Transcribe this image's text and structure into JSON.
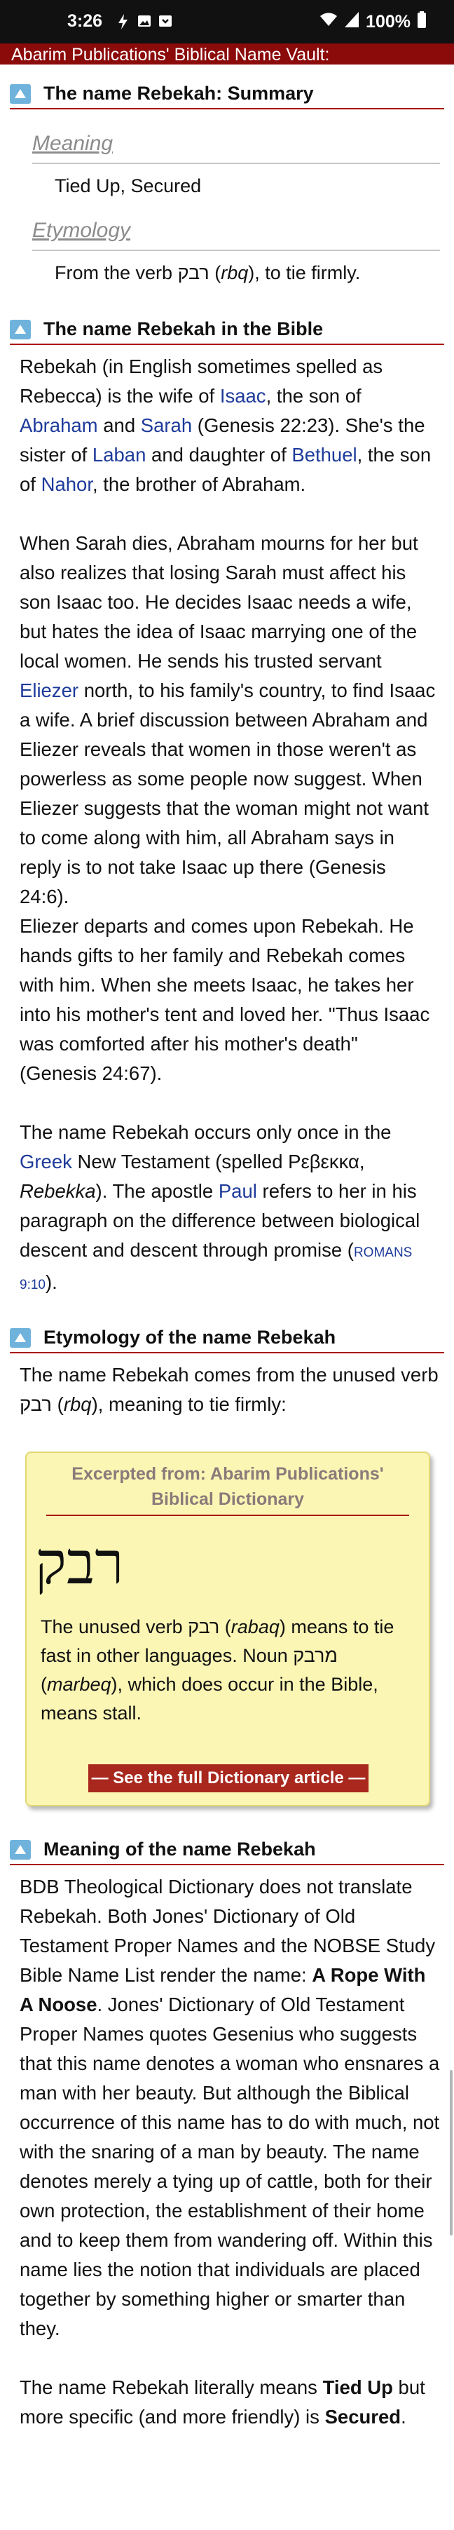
{
  "status_bar": {
    "time": "3:26",
    "battery": "100%"
  },
  "header": {
    "title": "Abarim Publications' Biblical Name Vault:"
  },
  "sections": {
    "summary": {
      "title": "The name Rebekah: Summary",
      "meaning_label": "Meaning",
      "meaning_value": "Tied Up, Secured",
      "etym_label": "Etymology",
      "etym_value_pre": "From the verb ",
      "etym_heb": "רבק",
      "etym_paren_open": " (",
      "etym_translit": "rbq",
      "etym_value_post": "), to tie firmly."
    },
    "bible": {
      "title": "The name Rebekah in the Bible",
      "p1": {
        "t1": "Rebekah (in English sometimes spelled as Rebecca) is the wife of ",
        "isaac": "Isaac",
        "t2": ", the son of ",
        "abraham": "Abraham",
        "t3": " and ",
        "sarah": "Sarah",
        "t4": " (Genesis 22:23). She's the sister of ",
        "laban": "Laban",
        "t5": " and daughter of ",
        "bethuel": "Bethuel",
        "t6": ", the son of ",
        "nahor": "Nahor",
        "t7": ", the brother of Abraham."
      },
      "p2": {
        "t1": "When Sarah dies, Abraham mourns for her but also realizes that losing Sarah must affect his son Isaac too. He decides Isaac needs a wife, but hates the idea of Isaac marrying one of the local women. He sends his trusted servant ",
        "eliezer": "Eliezer",
        "t2": " north, to his family's country, to find Isaac a wife. A brief discussion between Abraham and Eliezer reveals that women in those weren't as powerless as some people now suggest. When Eliezer suggests that the woman might not want to come along with him, all Abraham says in reply is to not take Isaac up there (Genesis 24:6)."
      },
      "p3": "Eliezer departs and comes upon Rebekah. He hands gifts to her family and Rebekah comes with him. When she meets Isaac, he takes her into his mother's tent and loved her. \"Thus Isaac was comforted after his mother's death\" (Genesis 24:67).",
      "p4": {
        "t1": "The name Rebekah occurs only once in the ",
        "greek": "Greek",
        "t2": " New Testament (spelled Ρεβεκκα, ",
        "rebekka": "Rebekka",
        "t3": "). The apostle ",
        "paul": "Paul",
        "t4": " refers to her in his paragraph on the difference between biological descent and descent through promise (",
        "ref": "ROMANS 9:10",
        "t5": ")."
      }
    },
    "etymology": {
      "title": "Etymology of the name Rebekah",
      "intro_pre": "The name Rebekah comes from the unused verb ",
      "intro_heb": "רבק",
      "intro_paren_open": " (",
      "intro_translit": "rbq",
      "intro_post": "), meaning to tie firmly:",
      "dict": {
        "excerpt": "Excerpted from: Abarim Publications' Biblical Dictionary",
        "hebrew": "רבק",
        "t1": "The unused verb ",
        "heb1": "רבק",
        "t1b": " (",
        "translit1": "rabaq",
        "t2": ") means to tie fast in other languages. Noun ",
        "heb2": "מרבק",
        "t2b": " (",
        "translit2": "marbeq",
        "t3": "), which does occur in the Bible, means stall.",
        "button": "— See the full Dictionary article —"
      }
    },
    "meaning": {
      "title": "Meaning of the name Rebekah",
      "p1": {
        "t1": "BDB Theological Dictionary does not translate Rebekah. Both Jones' Dictionary of Old Testament Proper Names and the NOBSE Study Bible Name List render the name: ",
        "b1": "A Rope With A Noose",
        "t2": ". Jones' Dictionary of Old Testament Proper Names quotes Gesenius who suggests that this name denotes a woman who ensnares a man with her beauty. But although the Biblical occurrence of this name has to do with much, not with the snaring of a man by beauty. The name denotes merely a tying up of cattle, both for their own protection, the establishment of their home and to keep them from wandering off. Within this name lies the notion that individuals are placed together by something higher or smarter than they."
      },
      "p2": {
        "t1": "The name Rebekah literally means ",
        "b1": "Tied Up",
        "t2": " but more specific (and more friendly) is ",
        "b2": "Secured",
        "t3": "."
      }
    }
  }
}
